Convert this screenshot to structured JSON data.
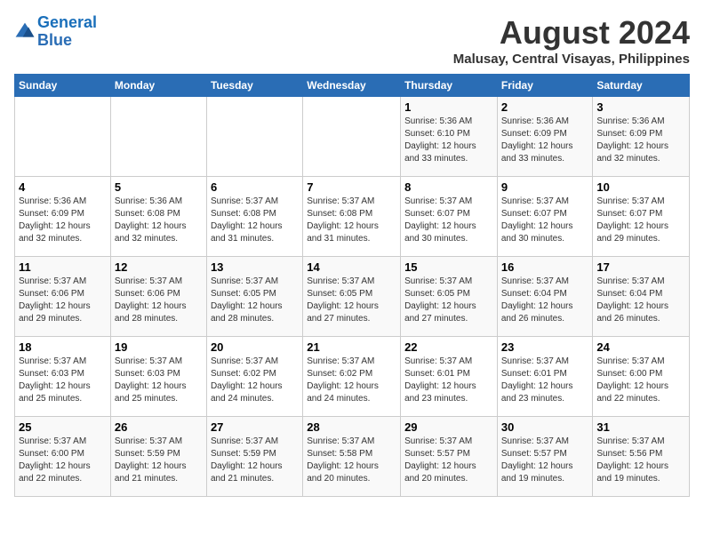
{
  "header": {
    "logo_line1": "General",
    "logo_line2": "Blue",
    "month_year": "August 2024",
    "location": "Malusay, Central Visayas, Philippines"
  },
  "weekdays": [
    "Sunday",
    "Monday",
    "Tuesday",
    "Wednesday",
    "Thursday",
    "Friday",
    "Saturday"
  ],
  "weeks": [
    [
      {
        "day": "",
        "info": ""
      },
      {
        "day": "",
        "info": ""
      },
      {
        "day": "",
        "info": ""
      },
      {
        "day": "",
        "info": ""
      },
      {
        "day": "1",
        "info": "Sunrise: 5:36 AM\nSunset: 6:10 PM\nDaylight: 12 hours\nand 33 minutes."
      },
      {
        "day": "2",
        "info": "Sunrise: 5:36 AM\nSunset: 6:09 PM\nDaylight: 12 hours\nand 33 minutes."
      },
      {
        "day": "3",
        "info": "Sunrise: 5:36 AM\nSunset: 6:09 PM\nDaylight: 12 hours\nand 32 minutes."
      }
    ],
    [
      {
        "day": "4",
        "info": "Sunrise: 5:36 AM\nSunset: 6:09 PM\nDaylight: 12 hours\nand 32 minutes."
      },
      {
        "day": "5",
        "info": "Sunrise: 5:36 AM\nSunset: 6:08 PM\nDaylight: 12 hours\nand 32 minutes."
      },
      {
        "day": "6",
        "info": "Sunrise: 5:37 AM\nSunset: 6:08 PM\nDaylight: 12 hours\nand 31 minutes."
      },
      {
        "day": "7",
        "info": "Sunrise: 5:37 AM\nSunset: 6:08 PM\nDaylight: 12 hours\nand 31 minutes."
      },
      {
        "day": "8",
        "info": "Sunrise: 5:37 AM\nSunset: 6:07 PM\nDaylight: 12 hours\nand 30 minutes."
      },
      {
        "day": "9",
        "info": "Sunrise: 5:37 AM\nSunset: 6:07 PM\nDaylight: 12 hours\nand 30 minutes."
      },
      {
        "day": "10",
        "info": "Sunrise: 5:37 AM\nSunset: 6:07 PM\nDaylight: 12 hours\nand 29 minutes."
      }
    ],
    [
      {
        "day": "11",
        "info": "Sunrise: 5:37 AM\nSunset: 6:06 PM\nDaylight: 12 hours\nand 29 minutes."
      },
      {
        "day": "12",
        "info": "Sunrise: 5:37 AM\nSunset: 6:06 PM\nDaylight: 12 hours\nand 28 minutes."
      },
      {
        "day": "13",
        "info": "Sunrise: 5:37 AM\nSunset: 6:05 PM\nDaylight: 12 hours\nand 28 minutes."
      },
      {
        "day": "14",
        "info": "Sunrise: 5:37 AM\nSunset: 6:05 PM\nDaylight: 12 hours\nand 27 minutes."
      },
      {
        "day": "15",
        "info": "Sunrise: 5:37 AM\nSunset: 6:05 PM\nDaylight: 12 hours\nand 27 minutes."
      },
      {
        "day": "16",
        "info": "Sunrise: 5:37 AM\nSunset: 6:04 PM\nDaylight: 12 hours\nand 26 minutes."
      },
      {
        "day": "17",
        "info": "Sunrise: 5:37 AM\nSunset: 6:04 PM\nDaylight: 12 hours\nand 26 minutes."
      }
    ],
    [
      {
        "day": "18",
        "info": "Sunrise: 5:37 AM\nSunset: 6:03 PM\nDaylight: 12 hours\nand 25 minutes."
      },
      {
        "day": "19",
        "info": "Sunrise: 5:37 AM\nSunset: 6:03 PM\nDaylight: 12 hours\nand 25 minutes."
      },
      {
        "day": "20",
        "info": "Sunrise: 5:37 AM\nSunset: 6:02 PM\nDaylight: 12 hours\nand 24 minutes."
      },
      {
        "day": "21",
        "info": "Sunrise: 5:37 AM\nSunset: 6:02 PM\nDaylight: 12 hours\nand 24 minutes."
      },
      {
        "day": "22",
        "info": "Sunrise: 5:37 AM\nSunset: 6:01 PM\nDaylight: 12 hours\nand 23 minutes."
      },
      {
        "day": "23",
        "info": "Sunrise: 5:37 AM\nSunset: 6:01 PM\nDaylight: 12 hours\nand 23 minutes."
      },
      {
        "day": "24",
        "info": "Sunrise: 5:37 AM\nSunset: 6:00 PM\nDaylight: 12 hours\nand 22 minutes."
      }
    ],
    [
      {
        "day": "25",
        "info": "Sunrise: 5:37 AM\nSunset: 6:00 PM\nDaylight: 12 hours\nand 22 minutes."
      },
      {
        "day": "26",
        "info": "Sunrise: 5:37 AM\nSunset: 5:59 PM\nDaylight: 12 hours\nand 21 minutes."
      },
      {
        "day": "27",
        "info": "Sunrise: 5:37 AM\nSunset: 5:59 PM\nDaylight: 12 hours\nand 21 minutes."
      },
      {
        "day": "28",
        "info": "Sunrise: 5:37 AM\nSunset: 5:58 PM\nDaylight: 12 hours\nand 20 minutes."
      },
      {
        "day": "29",
        "info": "Sunrise: 5:37 AM\nSunset: 5:57 PM\nDaylight: 12 hours\nand 20 minutes."
      },
      {
        "day": "30",
        "info": "Sunrise: 5:37 AM\nSunset: 5:57 PM\nDaylight: 12 hours\nand 19 minutes."
      },
      {
        "day": "31",
        "info": "Sunrise: 5:37 AM\nSunset: 5:56 PM\nDaylight: 12 hours\nand 19 minutes."
      }
    ]
  ]
}
